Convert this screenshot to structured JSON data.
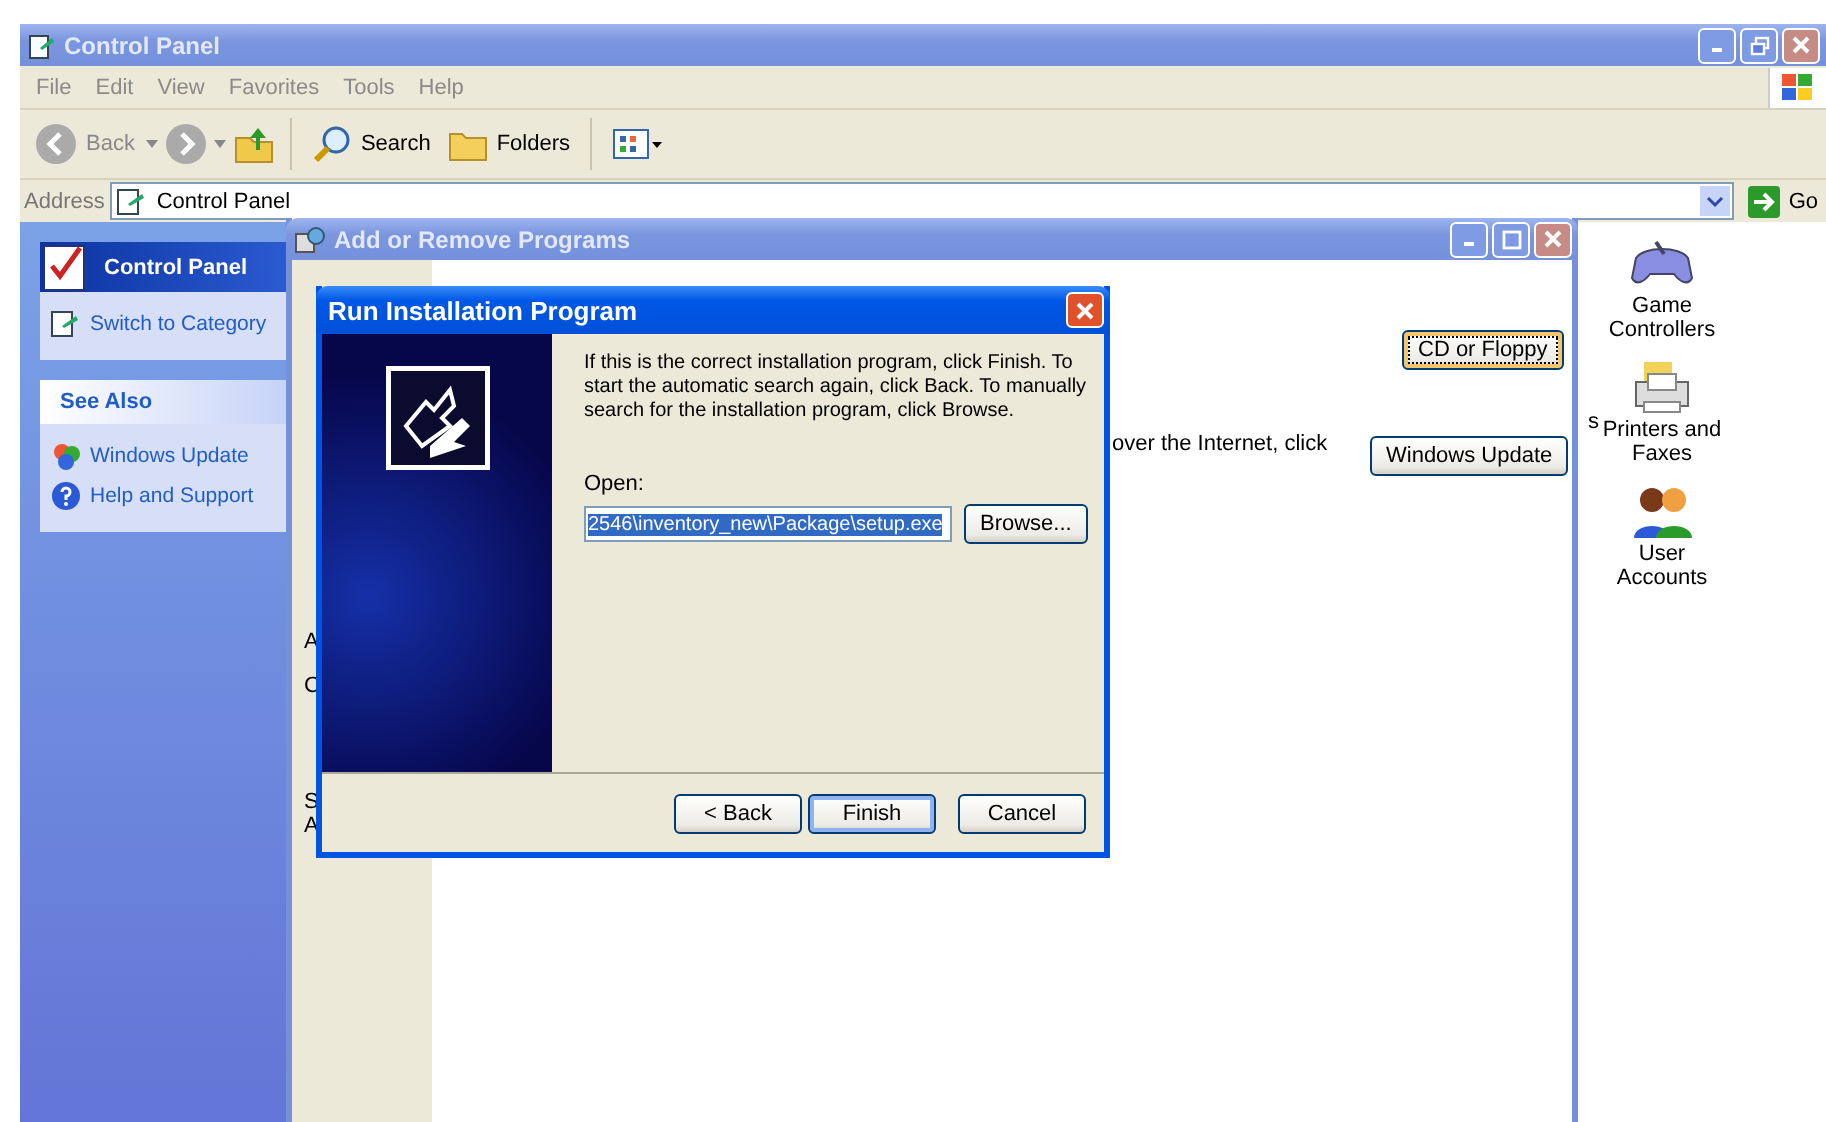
{
  "window": {
    "title": "Control Panel",
    "active": false
  },
  "menu": [
    "File",
    "Edit",
    "View",
    "Favorites",
    "Tools",
    "Help"
  ],
  "toolbar": {
    "back": "Back",
    "search": "Search",
    "folders": "Folders"
  },
  "address": {
    "label": "Address",
    "value": "Control Panel",
    "go": "Go"
  },
  "task_pane": {
    "title": "Control Panel",
    "switch_link": "Switch to Category",
    "see_also": {
      "title": "See Also",
      "links": [
        {
          "label": "Windows Update",
          "kind": "update"
        },
        {
          "label": "Help and Support",
          "kind": "help"
        }
      ]
    }
  },
  "cut_text": "s",
  "icons": [
    {
      "label": "Game Controllers",
      "kind": "gamepad"
    },
    {
      "label": "Printers and Faxes",
      "kind": "printer"
    },
    {
      "label": "User Accounts",
      "kind": "users"
    }
  ],
  "add_remove": {
    "title": "Add or Remove Programs",
    "active": false,
    "fragments": [
      "A",
      "C",
      "S",
      "A"
    ],
    "internet_text": "over the Internet, click",
    "buttons": [
      {
        "label": "CD or Floppy",
        "focused": true
      },
      {
        "label": "Windows Update",
        "focused": false
      }
    ]
  },
  "dialog": {
    "title": "Run Installation Program",
    "active": true,
    "message": "If this is the correct installation program, click Finish. To start the automatic search again, click Back. To manually search for the installation program, click Browse.",
    "open_label": "Open:",
    "open_value": "2546\\inventory_new\\Package\\setup.exe",
    "browse": "Browse...",
    "buttons": [
      {
        "label": "< Back",
        "default": false
      },
      {
        "label": "Finish",
        "default": true
      },
      {
        "label": "Cancel",
        "default": false
      }
    ]
  }
}
